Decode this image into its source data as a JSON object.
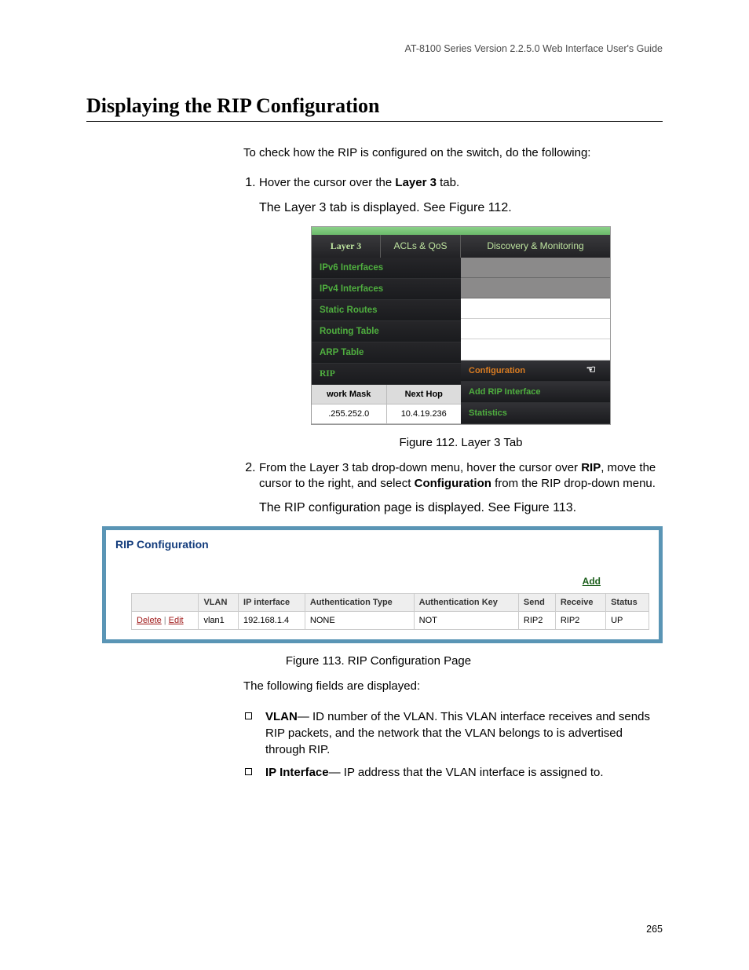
{
  "doc_header": "AT-8100 Series Version 2.2.5.0 Web Interface User's Guide",
  "section_title": "Displaying the RIP Configuration",
  "intro": "To check how the RIP is configured on the switch, do the following:",
  "step1_line1a": "Hover the cursor over the ",
  "step1_bold": "Layer 3",
  "step1_line1b": " tab.",
  "step1_sub": "The Layer 3 tab is displayed. See Figure 112.",
  "fig112": {
    "tabs": {
      "layer3": "Layer 3",
      "acls": "ACLs & QoS",
      "discovery": "Discovery & Monitoring"
    },
    "menu": {
      "ipv6": "IPv6 Interfaces",
      "ipv4": "IPv4 Interfaces",
      "static": "Static Routes",
      "routing": "Routing Table",
      "arp": "ARP Table",
      "rip": "RIP"
    },
    "rip_sub": {
      "configuration": "Configuration",
      "add_rip": "Add RIP Interface",
      "statistics": "Statistics"
    },
    "route_headers": {
      "mask": "work Mask",
      "nexthop": "Next Hop"
    },
    "route_values": {
      "mask": ".255.252.0",
      "nexthop": "10.4.19.236"
    }
  },
  "fig112_caption": "Figure 112. Layer 3 Tab",
  "step2_a": "From the Layer 3 tab drop-down menu, hover the cursor over ",
  "step2_bold1": "RIP",
  "step2_b": ", move the cursor to the right, and select ",
  "step2_bold2": "Configuration",
  "step2_c": " from the RIP drop-down menu.",
  "step2_sub": "The RIP configuration page is displayed. See Figure 113.",
  "fig113": {
    "title": "RIP Configuration",
    "add": "Add",
    "headers": {
      "vlan": "VLAN",
      "ip": "IP interface",
      "authtype": "Authentication Type",
      "authkey": "Authentication Key",
      "send": "Send",
      "receive": "Receive",
      "status": "Status"
    },
    "actions": {
      "delete": "Delete",
      "edit": "Edit"
    },
    "row": {
      "vlan": "vlan1",
      "ip": "192.168.1.4",
      "authtype": "NONE",
      "authkey": "NOT",
      "send": "RIP2",
      "receive": "RIP2",
      "status": "UP"
    }
  },
  "fig113_caption": "Figure 113. RIP Configuration Page",
  "following_fields": "The following fields are displayed:",
  "bullets": {
    "vlan_bold": "VLAN",
    "vlan_text": "— ID number of the VLAN. This VLAN interface receives and sends RIP packets, and the network that the VLAN belongs to is advertised through RIP.",
    "ipif_bold": "IP Interface",
    "ipif_text": "— IP address that the VLAN interface is assigned to."
  },
  "page_number": "265"
}
